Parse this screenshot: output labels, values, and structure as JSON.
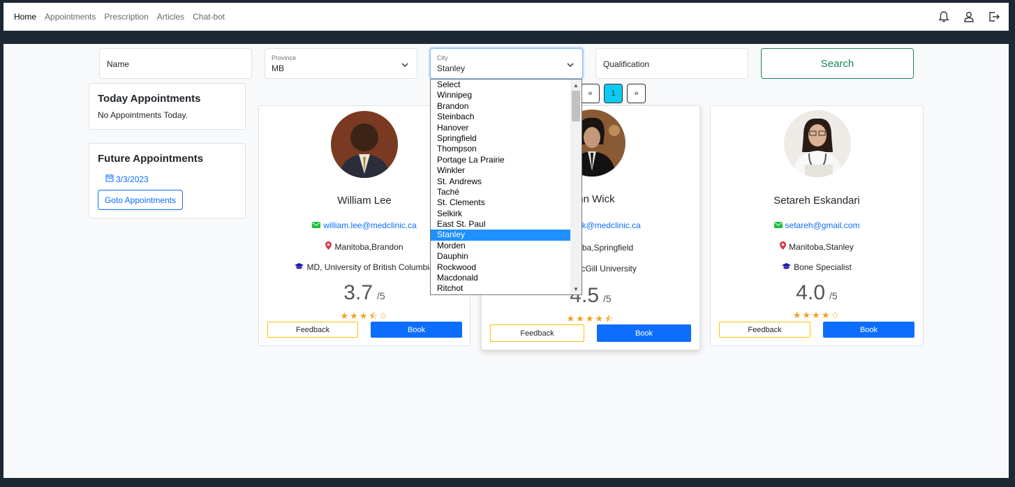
{
  "nav": {
    "links": [
      "Home",
      "Appointments",
      "Prescription",
      "Articles",
      "Chat-bot"
    ],
    "icons": [
      "bell-icon",
      "user-icon",
      "logout-icon"
    ]
  },
  "filters": {
    "name_placeholder": "Name",
    "province_label": "Province",
    "province_value": "MB",
    "city_label": "City",
    "city_value": "Stanley",
    "qualification_placeholder": "Qualification",
    "search_label": "Search"
  },
  "today": {
    "title": "Today Appointments",
    "message": "No Appointments Today."
  },
  "future": {
    "title": "Future Appointments",
    "date": "3/3/2023",
    "goto_label": "Goto Appointments"
  },
  "pager": {
    "prev": "«",
    "current": "1",
    "next": "»"
  },
  "doctors": [
    {
      "name": "William Lee",
      "email": "william.lee@medclinic.ca",
      "location": "Manitoba,Brandon",
      "qualification": "MD, University of British Columbia",
      "rating": "3.7",
      "rating_max": "/5",
      "stars": "★★★⯪☆",
      "feedback": "Feedback",
      "book": "Book"
    },
    {
      "name": "John Wick",
      "email": "john.wick@medclinic.ca",
      "location": "Manitoba,Springfield",
      "qualification": "MD, McGill University",
      "rating": "4.5",
      "rating_max": "/5",
      "stars": "★★★★⯪",
      "feedback": "Feedback",
      "book": "Book"
    },
    {
      "name": "Setareh Eskandari",
      "email": "setareh@gmail.com",
      "location": "Manitoba,Stanley",
      "qualification": "Bone Specialist",
      "rating": "4.0",
      "rating_max": "/5",
      "stars": "★★★★☆",
      "feedback": "Feedback",
      "book": "Book"
    }
  ],
  "city_options": [
    "Select",
    "Winnipeg",
    "Brandon",
    "Steinbach",
    "Hanover",
    "Springfield",
    "Thompson",
    "Portage La Prairie",
    "Winkler",
    "St. Andrews",
    "Taché",
    "St. Clements",
    "Selkirk",
    "East St. Paul",
    "Stanley",
    "Morden",
    "Dauphin",
    "Rockwood",
    "Macdonald",
    "Ritchot"
  ],
  "city_selected_index": 14,
  "colors": {
    "accent_blue": "#0d6efd",
    "search_green": "#198754",
    "pager_active": "#0dcaf0",
    "star": "#f0a020",
    "location_red": "#dc3545",
    "email_green": "#20c040",
    "cap_blue": "#1a1aa6"
  }
}
